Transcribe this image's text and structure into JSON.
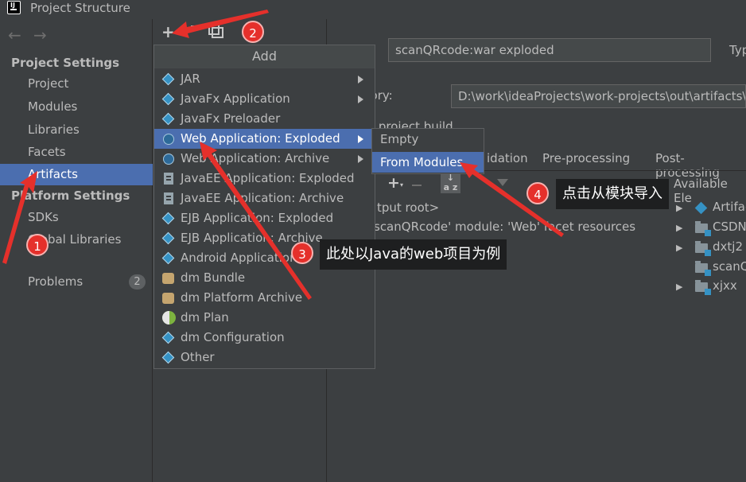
{
  "window": {
    "title": "Project Structure"
  },
  "sidebar": {
    "back_arrow": "←",
    "forward_arrow": "→",
    "project_settings_header": "Project Settings",
    "project_settings": [
      "Project",
      "Modules",
      "Libraries",
      "Facets",
      "Artifacts"
    ],
    "platform_settings_header": "Platform Settings",
    "platform_settings": [
      "SDKs",
      "Global Libraries"
    ],
    "problems_label": "Problems",
    "problems_count": "2",
    "selected": "Artifacts"
  },
  "toolbar": {
    "add_icon": "plus-icon",
    "remove_icon": "minus-icon",
    "copy_icon": "copy-icon"
  },
  "add_menu": {
    "title": "Add",
    "items": [
      {
        "label": "JAR",
        "icon": "diamond-icon",
        "has_submenu": true
      },
      {
        "label": "JavaFx Application",
        "icon": "diamond-icon",
        "has_submenu": true
      },
      {
        "label": "JavaFx Preloader",
        "icon": "diamond-icon",
        "has_submenu": false
      },
      {
        "label": "Web Application: Exploded",
        "icon": "globe-icon",
        "has_submenu": true,
        "selected": true
      },
      {
        "label": "Web Application: Archive",
        "icon": "globe-icon",
        "has_submenu": true
      },
      {
        "label": "JavaEE Application: Exploded",
        "icon": "jar-icon",
        "has_submenu": false
      },
      {
        "label": "JavaEE Application: Archive",
        "icon": "jar-icon",
        "has_submenu": false
      },
      {
        "label": "EJB Application: Exploded",
        "icon": "diamond-icon",
        "has_submenu": false
      },
      {
        "label": "EJB Application: Archive",
        "icon": "diamond-icon",
        "has_submenu": false
      },
      {
        "label": "Android Application",
        "icon": "diamond-icon",
        "has_submenu": false
      },
      {
        "label": "dm Bundle",
        "icon": "bundle-icon",
        "has_submenu": false
      },
      {
        "label": "dm Platform Archive",
        "icon": "bundle-icon",
        "has_submenu": false
      },
      {
        "label": "dm Plan",
        "icon": "plan-icon",
        "has_submenu": false
      },
      {
        "label": "dm Configuration",
        "icon": "diamond-icon",
        "has_submenu": false
      },
      {
        "label": "Other",
        "icon": "diamond-icon",
        "has_submenu": false
      }
    ]
  },
  "submenu": {
    "items": [
      "Empty",
      "From Modules..."
    ],
    "selected": "From Modules..."
  },
  "artifact": {
    "name": "scanQRcode:war exploded",
    "type_label": "Typ",
    "output_dir_label": "t directory:",
    "output_dir": "D:\\work\\ideaProjects\\work-projects\\out\\artifacts\\",
    "include_label": "clude in project build",
    "tabs": [
      "idation",
      "Pre-processing",
      "Post-processing"
    ],
    "available_label": "Available Ele",
    "output_tree": [
      "tput root>",
      "scanQRcode' module: 'Web' facet resources"
    ],
    "available_tree": [
      "Artifac",
      "CSDN",
      "dxtj2",
      "scanQ",
      "xjxx"
    ]
  },
  "annotations": {
    "step1": "1",
    "step2": "2",
    "step3": "3",
    "step4": "4",
    "callout3": "此处以Java的web项目为例",
    "callout4": "点击从模块导入"
  },
  "colors": {
    "accent": "#4b6eaf",
    "annotation": "#e5302b"
  }
}
